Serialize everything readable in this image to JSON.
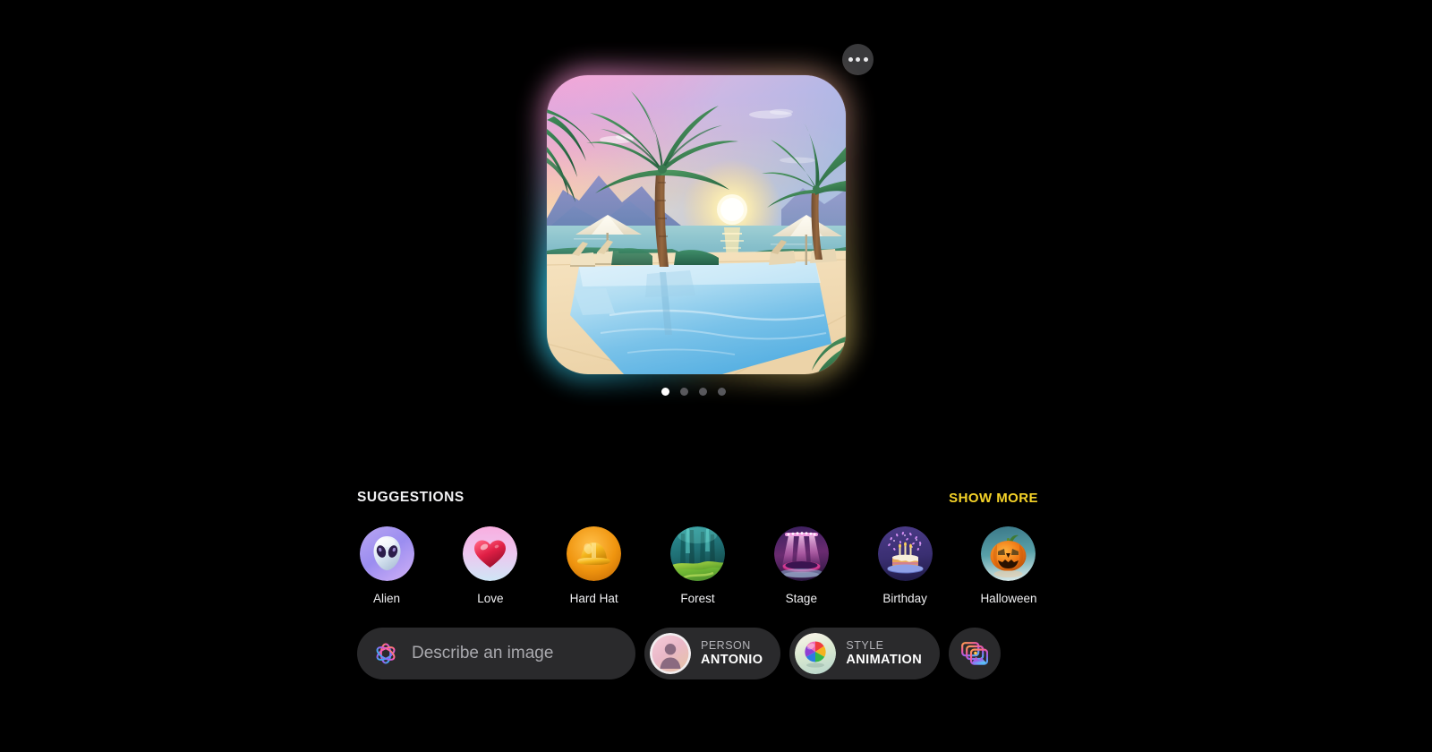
{
  "app": {
    "name": "Image Playground",
    "background_color": "#000000"
  },
  "header": {
    "more_button_icon": "ellipsis-icon"
  },
  "hero": {
    "alt": "Illustrated poolside sunset scene with palm trees, umbrellas, lounge chairs and an infinity pool facing the ocean",
    "glow_colors": [
      "#ff96d7",
      "#ffbaa0",
      "#3cdcff",
      "#ffe178"
    ],
    "carousel": {
      "total_pages": 4,
      "active_page": 1
    }
  },
  "suggestions": {
    "title": "SUGGESTIONS",
    "show_more_label": "SHOW MORE",
    "show_more_color": "#f5d328",
    "items": [
      {
        "label": "Alien",
        "icon": "alien-icon"
      },
      {
        "label": "Love",
        "icon": "heart-icon"
      },
      {
        "label": "Hard Hat",
        "icon": "hard-hat-icon"
      },
      {
        "label": "Forest",
        "icon": "forest-icon"
      },
      {
        "label": "Stage",
        "icon": "stage-icon"
      },
      {
        "label": "Birthday",
        "icon": "birthday-cake-icon"
      },
      {
        "label": "Halloween",
        "icon": "pumpkin-icon"
      }
    ]
  },
  "toolbar": {
    "describe": {
      "placeholder": "Describe an image",
      "value": "",
      "icon": "apple-intelligence-icon"
    },
    "person_chip": {
      "kind": "PERSON",
      "value": "ANTONIO",
      "icon": "person-avatar-icon"
    },
    "style_chip": {
      "kind": "STYLE",
      "value": "ANIMATION",
      "icon": "beach-ball-icon"
    },
    "photo_button": {
      "icon": "photo-stack-icon"
    }
  }
}
